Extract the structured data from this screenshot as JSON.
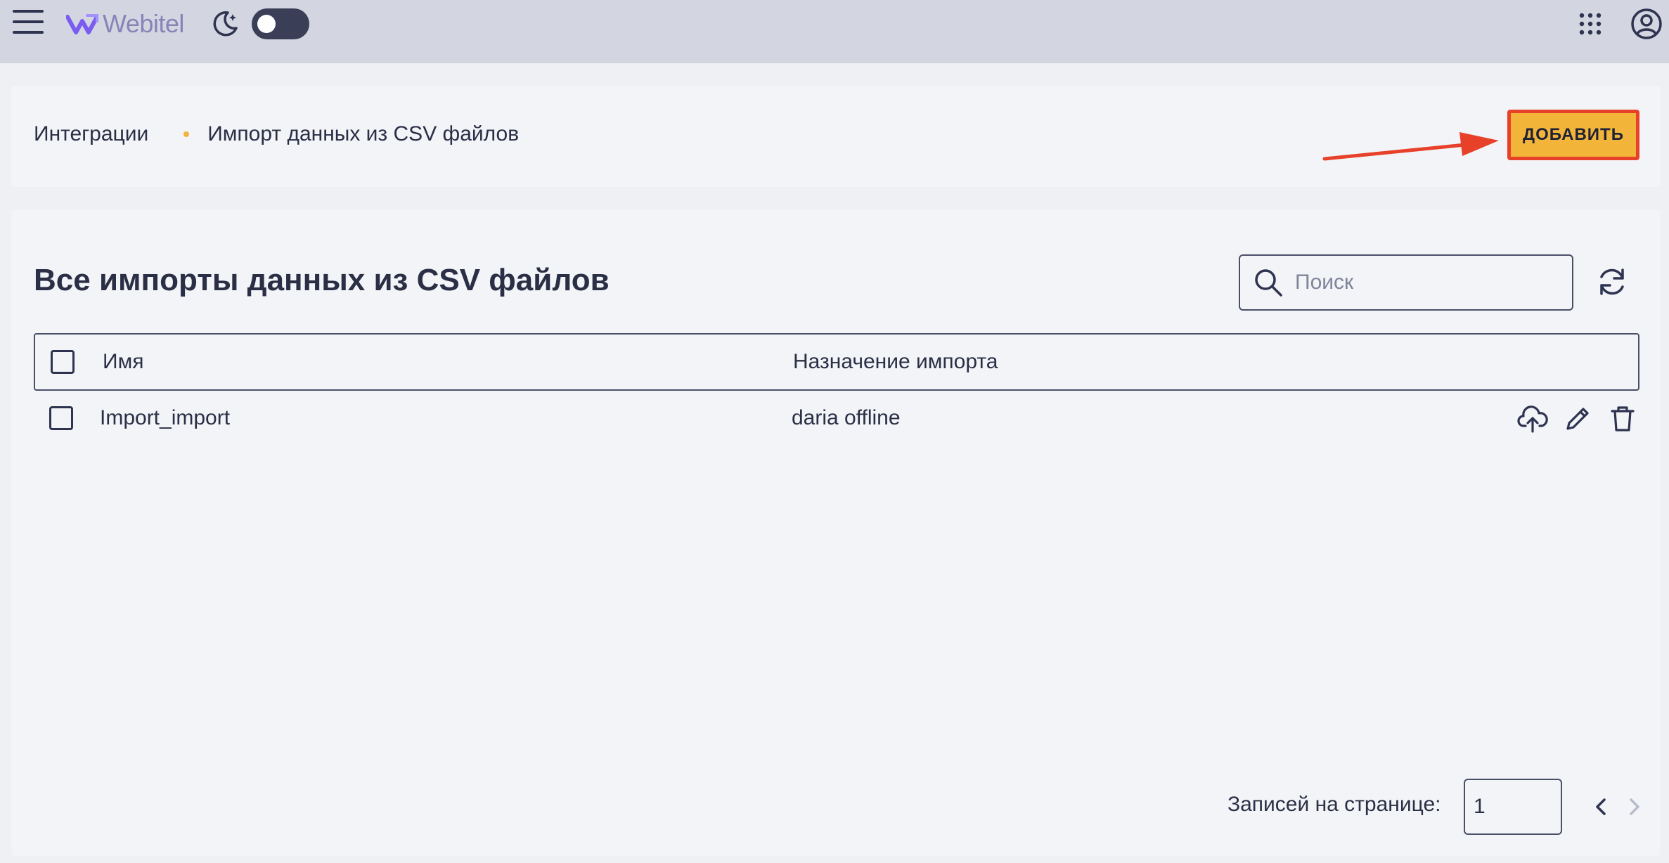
{
  "header": {
    "logo_text": "Webitel",
    "icons": [
      "menu-icon",
      "moon-icon",
      "apps-grid-icon",
      "user-account-icon"
    ],
    "theme_toggle": "off"
  },
  "breadcrumb": {
    "items": [
      "Интеграции",
      "Импорт данных из CSV файлов"
    ]
  },
  "actions": {
    "add_label": "ДОБАВИТЬ"
  },
  "main": {
    "title": "Все импорты данных из CSV файлов",
    "search": {
      "placeholder": "Поиск",
      "value": ""
    },
    "table": {
      "columns": [
        "Имя",
        "Назначение импорта"
      ],
      "rows": [
        {
          "name": "Import_import",
          "destination": "daria offline"
        }
      ],
      "row_actions": [
        "upload-icon",
        "edit-icon",
        "delete-icon"
      ]
    },
    "pagination": {
      "label": "Записей на странице:",
      "page_size": "1"
    }
  },
  "colors": {
    "accent": "#f2b53a",
    "annotation": "#e8412a",
    "header_bg": "#d3d6e1",
    "text": "#2a2f45"
  }
}
